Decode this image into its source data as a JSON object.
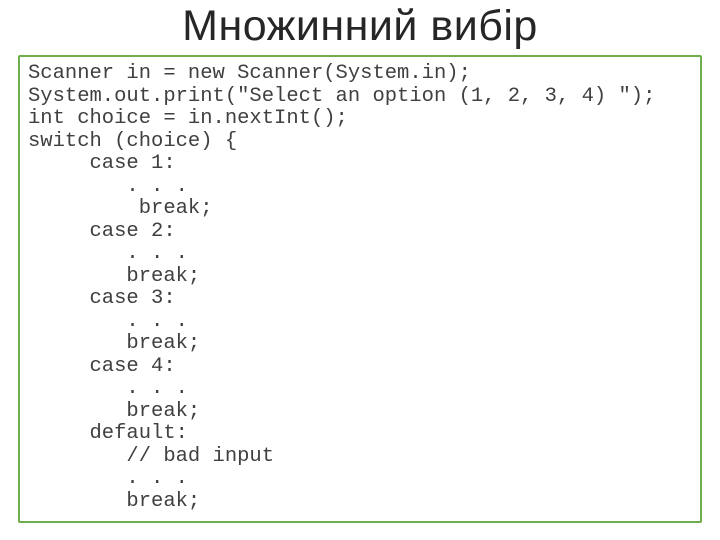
{
  "title": "Множинний вибір",
  "code": "Scanner in = new Scanner(System.in);\nSystem.out.print(\"Select an option (1, 2, 3, 4) \");\nint choice = in.nextInt();\nswitch (choice) {\n     case 1:\n        . . .\n         break;\n     case 2:\n        . . .\n        break;\n     case 3:\n        . . .\n        break;\n     case 4:\n        . . .\n        break;\n     default:\n        // bad input\n        . . .\n        break;"
}
